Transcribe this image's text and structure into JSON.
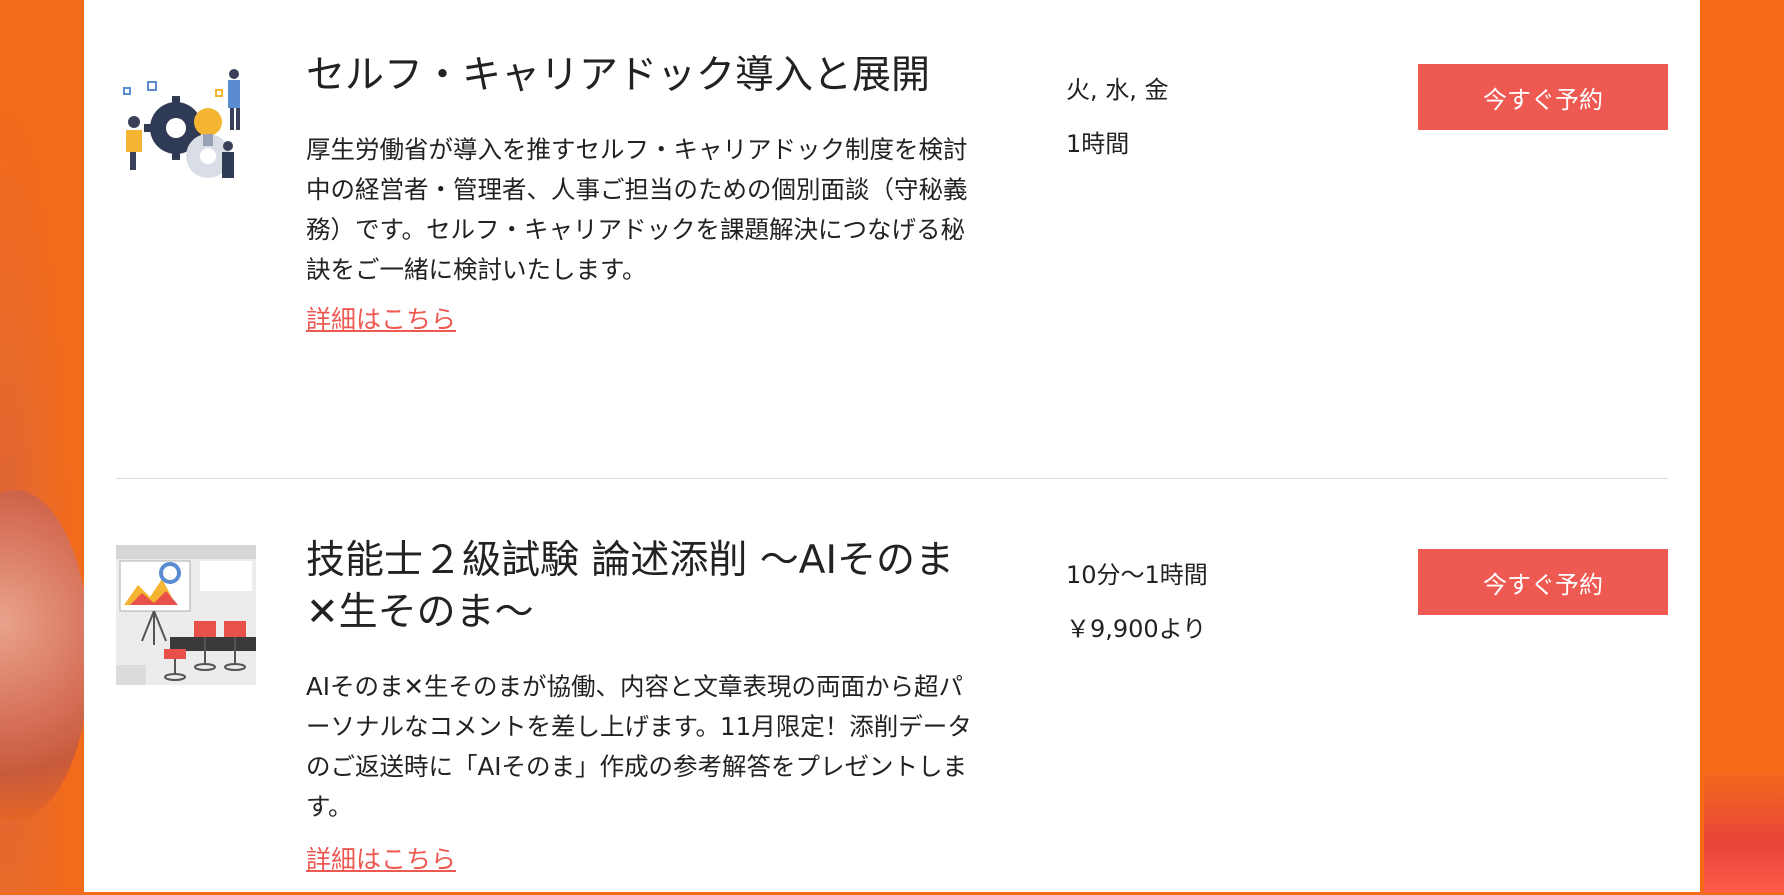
{
  "services": [
    {
      "title": "セルフ・キャリアドック導入と展開",
      "description": "厚生労働省が導入を推すセルフ・キャリアドック制度を検討中の経営者・管理者、人事ご担当のための個別面談（守秘義務）です。セルフ・キャリアドックを課題解決につなげる秘訣をご一緒に検討いたします。",
      "details_link": "詳細はこちら",
      "days": "火, 水, 金",
      "duration": "1時間",
      "book_label": "今すぐ予約",
      "image_icon": "career-dock-illustration"
    },
    {
      "title": "技能士２級試験 論述添削 ～AIそのま✕生そのま～",
      "description": "AIそのま✕生そのまが協働、内容と文章表現の両面から超パーソナルなコメントを差し上げます。11月限定！添削データのご返送時に「AIそのま」作成の参考解答をプレゼントします。",
      "details_link": "詳細はこちら",
      "duration": "10分〜1時間",
      "price": "￥9,900より",
      "book_label": "今すぐ予約",
      "image_icon": "presentation-meeting-illustration"
    }
  ],
  "colors": {
    "accent": "#ee5a52",
    "background": "#f26a1b",
    "panel": "#ffffff",
    "text": "#222222"
  }
}
